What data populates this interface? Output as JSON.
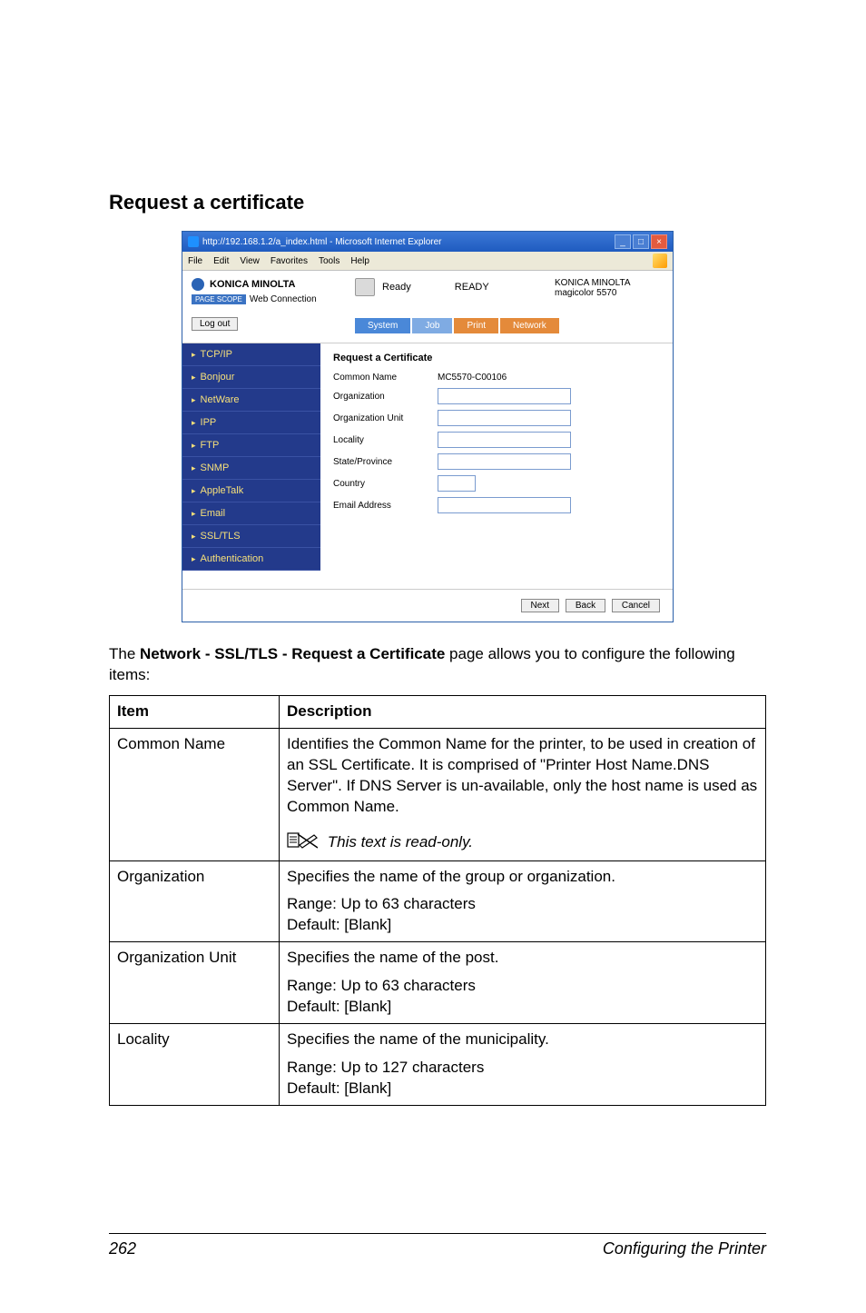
{
  "heading": "Request a certificate",
  "ie": {
    "title": "http://192.168.1.2/a_index.html - Microsoft Internet Explorer",
    "menu": {
      "file": "File",
      "edit": "Edit",
      "view": "View",
      "favorites": "Favorites",
      "tools": "Tools",
      "help": "Help"
    },
    "brand": "KONICA MINOLTA",
    "pagescope_prefix": "PAGE SCOPE",
    "pagescope": "Web Connection",
    "ready_icon_label": "Ready",
    "status_text": "READY",
    "model_line1": "KONICA MINOLTA",
    "model_line2": "magicolor 5570",
    "logout": "Log out",
    "tabs": {
      "system": "System",
      "job": "Job",
      "print": "Print",
      "network": "Network"
    },
    "sidebar": [
      "TCP/IP",
      "Bonjour",
      "NetWare",
      "IPP",
      "FTP",
      "SNMP",
      "AppleTalk",
      "Email",
      "SSL/TLS",
      "Authentication"
    ],
    "form_title": "Request a Certificate",
    "fields": {
      "common_name": "Common Name",
      "common_name_value": "MC5570-C00106",
      "organization": "Organization",
      "organization_unit": "Organization Unit",
      "locality": "Locality",
      "state": "State/Province",
      "country": "Country",
      "email": "Email Address"
    },
    "buttons": {
      "next": "Next",
      "back": "Back",
      "cancel": "Cancel"
    }
  },
  "body_text_pre": "The ",
  "body_text_bold": "Network - SSL/TLS - Request a Certificate",
  "body_text_post": " page allows you to configure the following items:",
  "table": {
    "header_item": "Item",
    "header_desc": "Description",
    "rows": {
      "common_name": {
        "item": "Common Name",
        "desc": "Identifies the Common Name for the printer, to be used in creation of an SSL Certificate. It is comprised of \"Printer Host Name.DNS Server\". If DNS Server is un-available, only the host name is used as Common Name.",
        "note": "This text is read-only."
      },
      "organization": {
        "item": "Organization",
        "desc": "Specifies the name of the group or organization.",
        "range": "Range:   Up to 63 characters",
        "default": "Default:  [Blank]"
      },
      "organization_unit": {
        "item": "Organization Unit",
        "desc": "Specifies the name of the post.",
        "range": "Range:   Up to 63 characters",
        "default": "Default:  [Blank]"
      },
      "locality": {
        "item": "Locality",
        "desc": "Specifies the name of the municipality.",
        "range": "Range:   Up to 127 characters",
        "default": "Default:  [Blank]"
      }
    }
  },
  "footer": {
    "page": "262",
    "section": "Configuring the Printer"
  }
}
